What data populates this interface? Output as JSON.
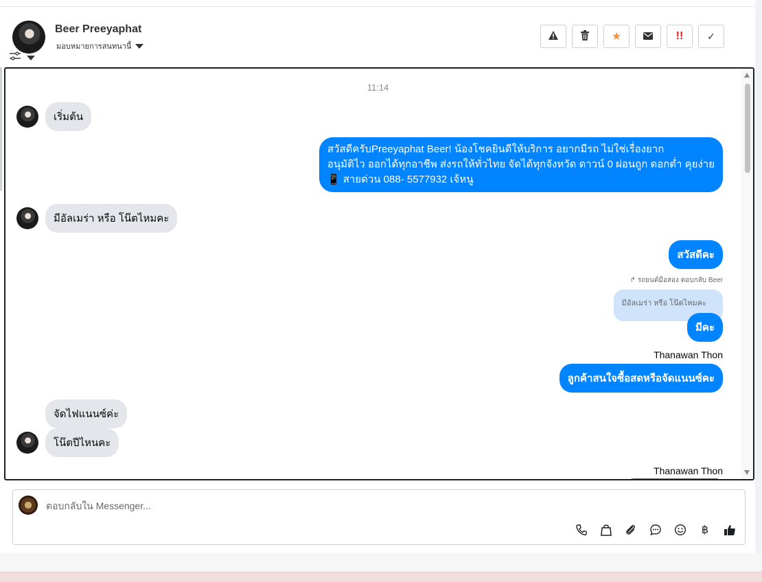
{
  "header": {
    "contact_name": "Beer Preeyaphat",
    "assign_label": "มอบหมายการสนทนานี้"
  },
  "actions": [
    {
      "name": "spam-button",
      "icon": "warning-icon",
      "glyph": "⚠"
    },
    {
      "name": "delete-button",
      "icon": "trash-icon",
      "glyph": "🗑"
    },
    {
      "name": "star-button",
      "icon": "star-icon",
      "glyph": "★"
    },
    {
      "name": "mark-unread-button",
      "icon": "envelope-icon",
      "glyph": "✉"
    },
    {
      "name": "priority-button",
      "icon": "double-exclamation-icon",
      "glyph": "‼"
    },
    {
      "name": "done-button",
      "icon": "check-icon",
      "glyph": "✓"
    }
  ],
  "conversation": {
    "timestamp": "11:14",
    "msg1": "เริ่มต้น",
    "msg2_line1": "สวัสดีครับPreeyaphat Beer! น้องโชคยินดีให้บริการ อยากมีรถ ไม่ใช่เรื่องยาก",
    "msg2_line2": "อนุมัติไว ออกได้ทุกอาชีพ ส่งรถให้ทั่วไทย จัดได้ทุกจังหวัด ดาวน์ 0  ผ่อนถูก ดอกต่ำ คุยง่าย",
    "msg2_line3": "📱 สายด่วน 088- 5577932 เจ้หนู",
    "msg3": "มีอัลเมร่า หรือ โน๊ตไหมคะ",
    "msg4": "สวัสดีคะ",
    "reply_meta": "↱ รถยนต์มือสอง ตอบกลับ Beer",
    "quoted": "มีอัลเมร่า หรือ โน๊ตไหมคะ",
    "msg5": "มีคะ",
    "sender1": "Thanawan Thon",
    "msg6": "ลูกค้าสนใจซื้อสดหรือจัดแนนซ์คะ",
    "msg7": "จัดไฟแนนซ์ค่ะ",
    "msg8": "โน๊ตปีไหนคะ",
    "sender2": "Thanawan Thon"
  },
  "composer": {
    "placeholder": "ตอบกลับใน Messenger...",
    "tools": [
      "phone-icon",
      "shopping-bag-icon",
      "paperclip-icon",
      "chat-bubble-icon",
      "emoji-icon",
      "baht-icon",
      "thumbs-up-icon"
    ]
  },
  "colors": {
    "outgoing": "#0084ff",
    "incoming": "#e4e6eb",
    "star": "#f7923a",
    "priority": "#e02020"
  }
}
